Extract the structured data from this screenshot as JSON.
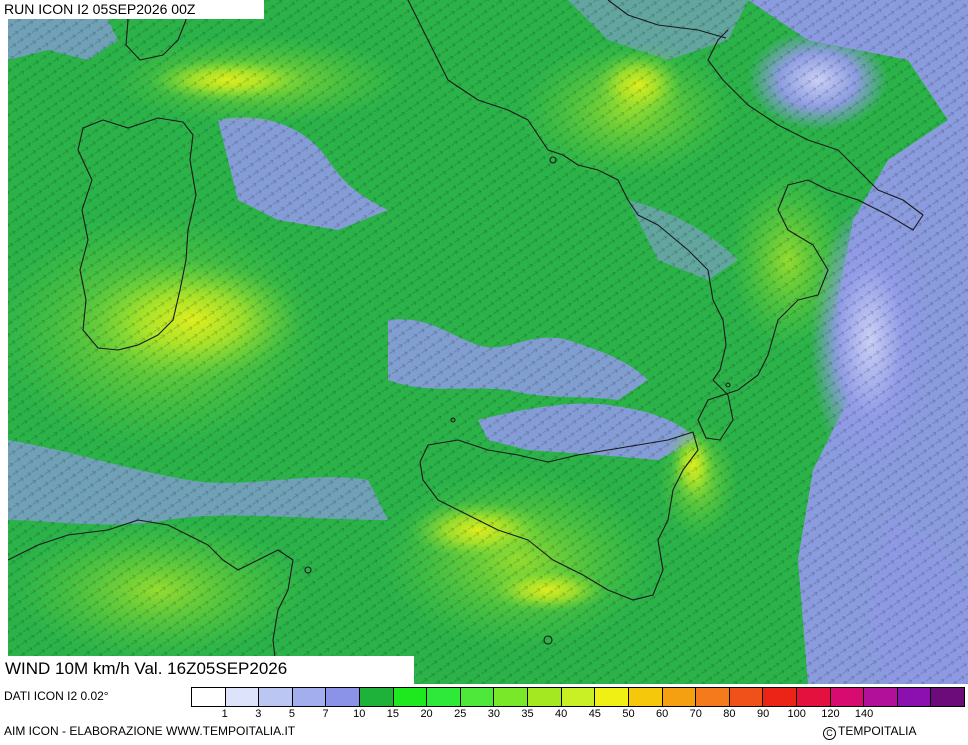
{
  "header": {
    "run": "RUN ICON I2 05SEP2026 00Z"
  },
  "footer": {
    "validity": "WIND 10M km/h Val. 16Z05SEP2026",
    "source": "DATI ICON I2 0.02°",
    "credit": "AIM ICON - ELABORAZIONE WWW.TEMPOITALIA.IT",
    "brand": "TEMPOITALIA",
    "copyright_symbol": "C"
  },
  "legend": {
    "colors": [
      "#ffffff",
      "#dce3fa",
      "#bcc6f2",
      "#a3aeee",
      "#8b93e8",
      "#1fb23a",
      "#1ee81e",
      "#2ee83a",
      "#4ee83a",
      "#79e828",
      "#a3e820",
      "#c9f024",
      "#f0f014",
      "#f6c80c",
      "#f4a010",
      "#f47a1c",
      "#f0501a",
      "#ec2418",
      "#e4103e",
      "#d80c70",
      "#b2109a",
      "#8c10b0",
      "#6c0c7a"
    ],
    "ticks": [
      "1",
      "3",
      "5",
      "7",
      "10",
      "15",
      "20",
      "25",
      "30",
      "35",
      "40",
      "45",
      "50",
      "60",
      "70",
      "80",
      "90",
      "100",
      "120",
      "140"
    ]
  },
  "map_features": {
    "base_color": "#2bb34a",
    "calm_color": "#8f9ae6",
    "strong_color": "#d7ec1a"
  }
}
